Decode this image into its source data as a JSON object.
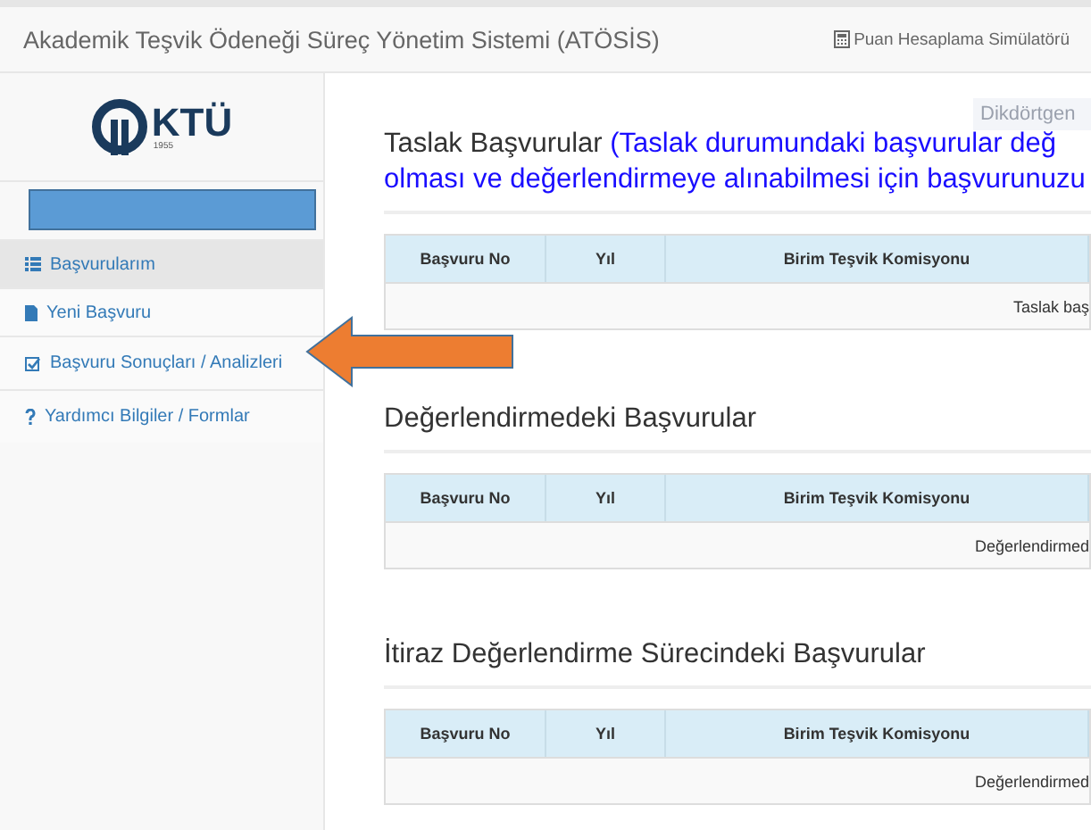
{
  "header": {
    "title": "Akademik Teşvik Ödeneği Süreç Yönetim Sistemi (ATÖSİS)",
    "link": "Puan Hesaplama Simülatörü"
  },
  "logo": {
    "text": "KTÜ",
    "year": "1955"
  },
  "sidebar": {
    "items": [
      {
        "label": "Başvurularım",
        "kind": "list",
        "selected": true
      },
      {
        "label": "Yeni Başvuru",
        "kind": "new",
        "selected": false
      },
      {
        "label": "Başvuru Sonuçları / Analizleri",
        "kind": "results",
        "selected": false
      },
      {
        "label": "Yardımcı Bilgiler / Formlar",
        "kind": "help",
        "selected": false
      }
    ]
  },
  "tooltip": "Dikdörtgen",
  "sections": [
    {
      "title": "Taslak Başvurular",
      "note": [
        "(Taslak durumundaki başvurular değ",
        "olması ve değerlendirmeye alınabilmesi için başvurunuzu"
      ],
      "columns": [
        "Başvuru No",
        "Yıl",
        "Birim Teşvik Komisyonu"
      ],
      "empty": "Taslak baş"
    },
    {
      "title": "Değerlendirmedeki Başvurular",
      "columns": [
        "Başvuru No",
        "Yıl",
        "Birim Teşvik Komisyonu"
      ],
      "empty": "Değerlendirmed"
    },
    {
      "title": "İtiraz Değerlendirme Sürecindeki Başvurular",
      "columns": [
        "Başvuru No",
        "Yıl",
        "Birim Teşvik Komisyonu"
      ],
      "empty": "Değerlendirmed"
    }
  ]
}
